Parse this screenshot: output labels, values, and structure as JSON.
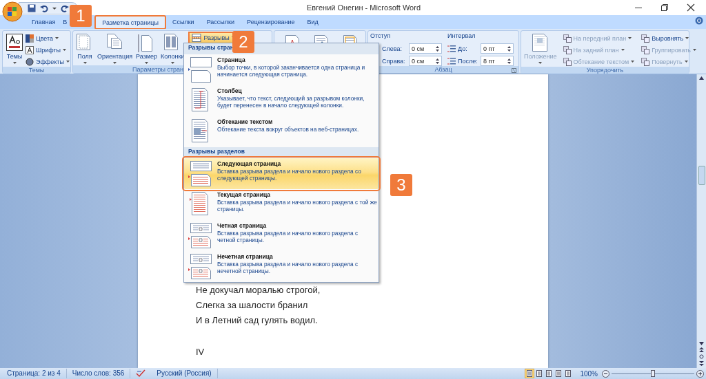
{
  "window": {
    "title": "Евгений Онегин - Microsoft Word"
  },
  "tabs": [
    {
      "label": "Главная",
      "selected": false,
      "highlighted": false
    },
    {
      "label": "В",
      "selected": false,
      "highlighted": false
    },
    {
      "label": "Разметка страницы",
      "selected": true,
      "highlighted": true
    },
    {
      "label": "Ссылки",
      "selected": false,
      "highlighted": false
    },
    {
      "label": "Рассылки",
      "selected": false,
      "highlighted": false
    },
    {
      "label": "Рецензирование",
      "selected": false,
      "highlighted": false
    },
    {
      "label": "Вид",
      "selected": false,
      "highlighted": false
    }
  ],
  "ribbon": [
    {
      "kind": "themes",
      "label": "Темы",
      "big": "Темы",
      "small": [
        {
          "label": "Цвета",
          "disabled": false
        },
        {
          "label": "Шрифты",
          "disabled": false
        },
        {
          "label": "Эффекты",
          "disabled": false
        }
      ]
    },
    {
      "kind": "page_setup",
      "label": "Параметры стран",
      "big": [
        "Поля",
        "Ориентация",
        "Размер",
        "Колонки"
      ],
      "breaks": {
        "label": "Разрывы",
        "highlighted": true
      }
    },
    {
      "kind": "page_background"
    },
    {
      "kind": "paragraph",
      "label": "Абзац",
      "indent": {
        "heading": "Отступ",
        "fields": [
          {
            "label": "Слева:",
            "value": "0 см"
          },
          {
            "label": "Справа:",
            "value": "0 см"
          }
        ]
      },
      "spacing": {
        "heading": "Интервал",
        "fields": [
          {
            "label": "До:",
            "value": "0 пт"
          },
          {
            "label": "После:",
            "value": "8 пт"
          }
        ]
      }
    },
    {
      "kind": "arrange",
      "label": "Упорядочить",
      "big": {
        "label": "Положение",
        "disabled": true
      },
      "small": [
        {
          "label": "На передний план",
          "disabled": true
        },
        {
          "label": "На задний план",
          "disabled": true
        },
        {
          "label": "Обтекание текстом",
          "disabled": true
        },
        {
          "label": "Выровнять",
          "disabled": false
        },
        {
          "label": "Группировать",
          "disabled": true
        },
        {
          "label": "Повернуть",
          "disabled": true
        }
      ]
    }
  ],
  "menu": {
    "sections": [
      {
        "heading": "Разрывы стран",
        "items": [
          {
            "kind": "page",
            "title": "Страница",
            "description": "Выбор точки, в которой заканчивается одна страница и начинается следующая страница.",
            "selected": false,
            "highlighted": false
          },
          {
            "kind": "column",
            "title": "Столбец",
            "description": "Указывает, что текст, следующий за разрывом колонки, будет перенесен в начало следующей колонки.",
            "selected": false,
            "highlighted": false
          },
          {
            "kind": "wrap",
            "title": "Обтекание текстом",
            "description": "Обтекание текста вокруг объектов на веб-страницах.",
            "selected": false,
            "highlighted": false
          }
        ]
      },
      {
        "heading": "Разрывы разделов",
        "items": [
          {
            "kind": "next",
            "title": "Следующая страница",
            "description": "Вставка разрыва раздела и начало нового раздела со следующей страницы.",
            "selected": true,
            "highlighted": true
          },
          {
            "kind": "continuous",
            "title": "Текущая страница",
            "description": "Вставка разрыва раздела и начало нового раздела с той же страницы.",
            "selected": false,
            "highlighted": false
          },
          {
            "kind": "even",
            "title": "Четная страница",
            "description": "Вставка разрыва раздела и начало нового раздела с четной страницы.",
            "selected": false,
            "highlighted": false
          },
          {
            "kind": "odd",
            "title": "Нечетная страница",
            "description": "Вставка разрыва раздела и начало нового раздела с нечетной страницы.",
            "selected": false,
            "highlighted": false
          }
        ]
      }
    ]
  },
  "document": {
    "stanzas": [
      [
        "Не докучал моралью строгой,",
        "Слегка за шалости бранил",
        "И в Летний сад гулять водил."
      ],
      [
        "IV"
      ]
    ]
  },
  "status_bar": {
    "page": "Страница: 2 из 4",
    "words": "Число слов: 356",
    "language": "Русский (Россия)",
    "zoom": "100%",
    "zoom_level": {
      "level": 0.5
    }
  },
  "callouts": [
    {
      "number": "1"
    },
    {
      "number": "2"
    },
    {
      "number": "3"
    }
  ]
}
